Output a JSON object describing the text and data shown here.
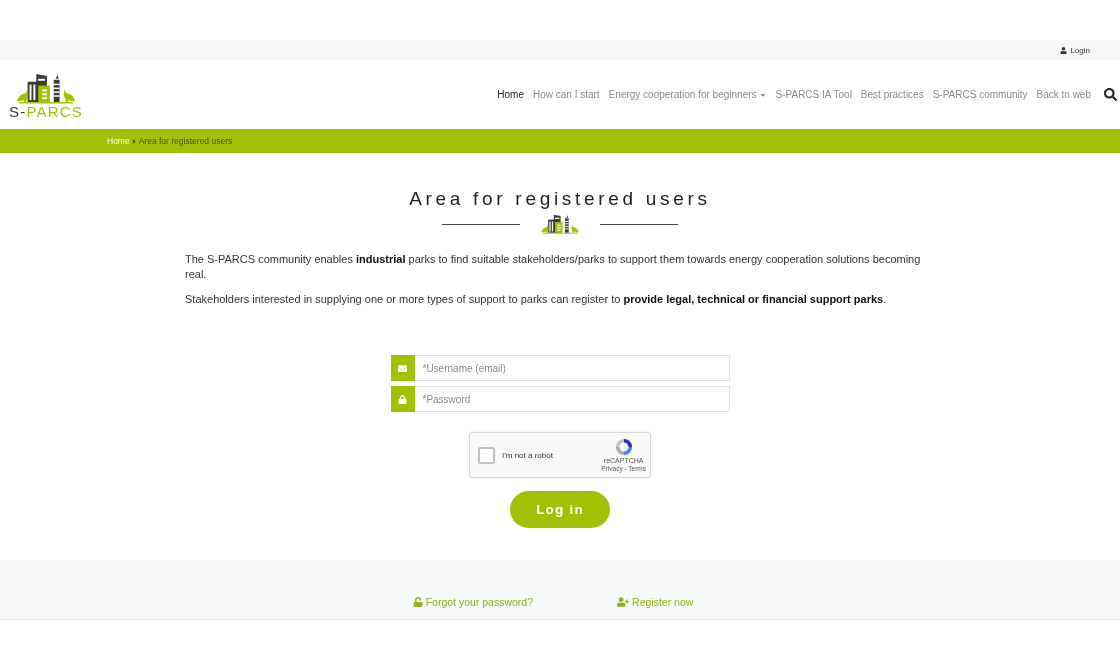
{
  "top_bar": {
    "login_link": "Login"
  },
  "logo": {
    "dark_part": "S-",
    "green_part": "PARCS"
  },
  "nav": {
    "items": [
      {
        "label": "Home",
        "selected": true,
        "dropdown": false
      },
      {
        "label": "How can I start",
        "selected": false,
        "dropdown": false
      },
      {
        "label": "Energy cooperation for beginners",
        "selected": false,
        "dropdown": true
      },
      {
        "label": "S-PARCS IA Tool",
        "selected": false,
        "dropdown": false
      },
      {
        "label": "Best practices",
        "selected": false,
        "dropdown": false
      },
      {
        "label": "S-PARCS community",
        "selected": false,
        "dropdown": false
      },
      {
        "label": "Back to web",
        "selected": false,
        "dropdown": false
      }
    ]
  },
  "breadcrumb": [
    {
      "label": "Home",
      "kind": "link"
    },
    {
      "label": "Area for registered users",
      "kind": "current"
    }
  ],
  "title": "Area for registered users",
  "paragraphs": [
    "The S-PARCS community enables **industrial** parks to find suitable stakeholders/parks to support them towards energy cooperation solutions becoming real.",
    "Stakeholders interested in supplying one or more types of support to parks can register to **provide legal, technical or financial support parks**."
  ],
  "form": {
    "fields": [
      {
        "kind": "email",
        "placeholder": "*Username (email)"
      },
      {
        "kind": "password",
        "placeholder": "*Password"
      }
    ],
    "captcha": {
      "label": "I'm not a robot",
      "checked": false,
      "brand": "reCAPTCHA",
      "terms": "Privacy - Terms"
    },
    "submit": "Log in"
  },
  "footer_links": [
    {
      "label": "Forgot your password?",
      "kind": "forgot"
    },
    {
      "label": "Register now",
      "kind": "register"
    }
  ]
}
